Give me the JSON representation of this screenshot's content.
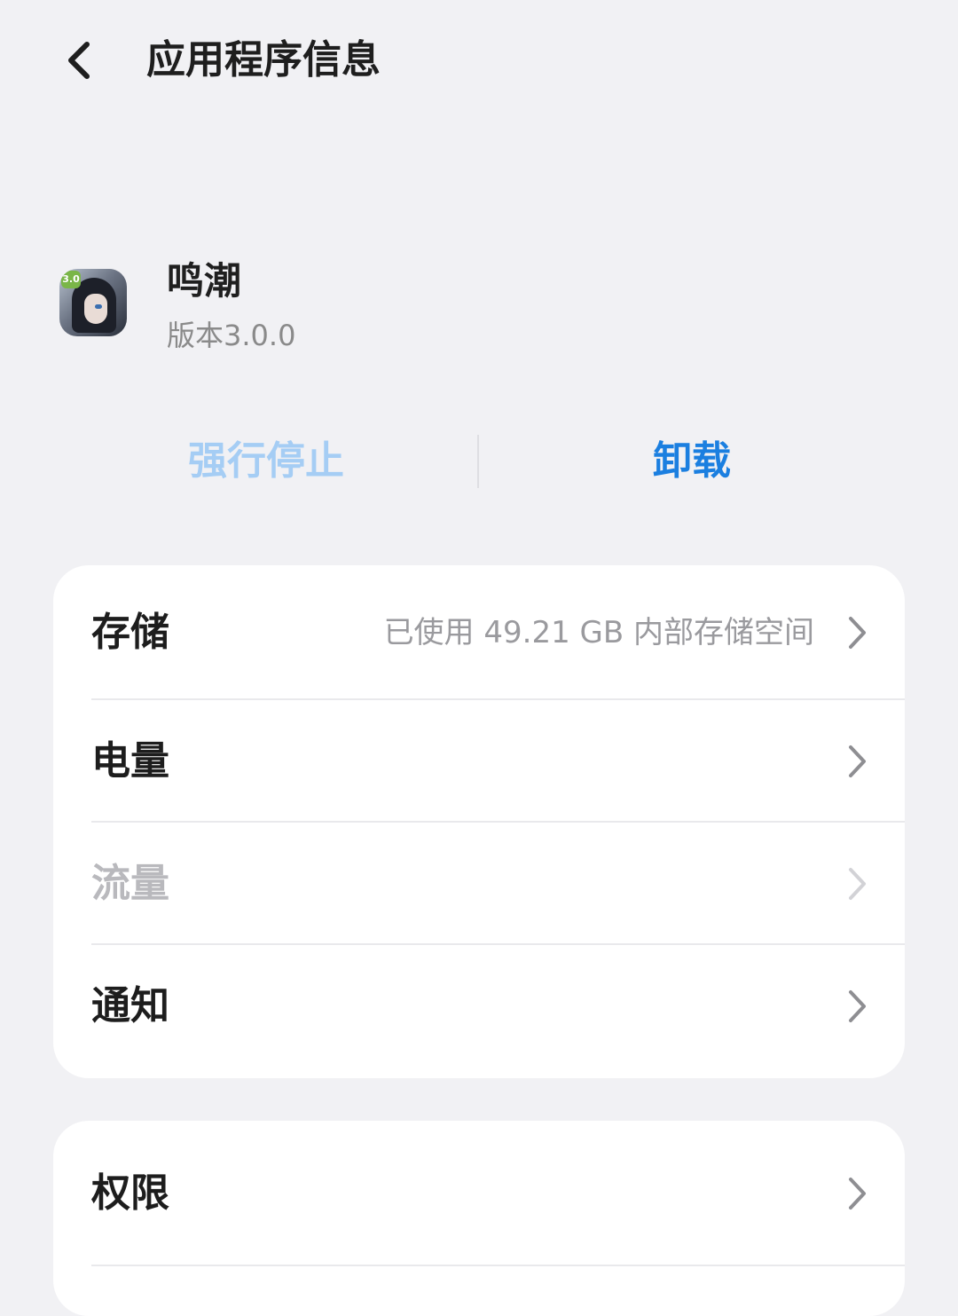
{
  "header": {
    "title": "应用程序信息",
    "back_icon": "chevron-left-icon"
  },
  "app": {
    "name": "鸣潮",
    "version": "版本3.0.0",
    "icon_badge": "3.0"
  },
  "actions": {
    "force_stop_label": "强行停止",
    "uninstall_label": "卸载",
    "force_stop_color": "#a5cdf4",
    "uninstall_color": "#1b7fe0"
  },
  "settings_group_1": {
    "items": [
      {
        "label": "存储",
        "value": "已使用 49.21 GB 内部存储空间",
        "enabled": true
      },
      {
        "label": "电量",
        "value": "",
        "enabled": true
      },
      {
        "label": "流量",
        "value": "",
        "enabled": false
      },
      {
        "label": "通知",
        "value": "",
        "enabled": true
      }
    ]
  },
  "settings_group_2": {
    "items": [
      {
        "label": "权限",
        "value": "",
        "enabled": true
      }
    ]
  },
  "colors": {
    "background": "#f1f1f4",
    "card": "#ffffff",
    "accent": "#1b7fe0"
  }
}
